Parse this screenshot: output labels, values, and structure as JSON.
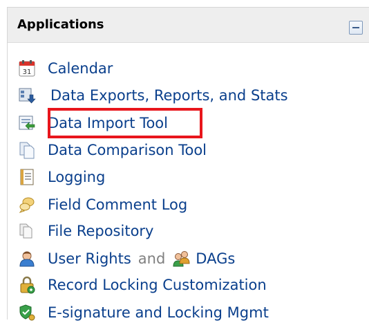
{
  "panel": {
    "title": "Applications"
  },
  "items": [
    {
      "label": "Calendar",
      "icon": "calendar-icon"
    },
    {
      "label": "Data Exports, Reports, and Stats",
      "icon": "data-export-icon"
    },
    {
      "label": "Data Import Tool",
      "icon": "data-import-icon",
      "highlighted": true
    },
    {
      "label": "Data Comparison Tool",
      "icon": "documents-icon"
    },
    {
      "label": "Logging",
      "icon": "log-icon"
    },
    {
      "label": "Field Comment Log",
      "icon": "comment-balloon-icon"
    },
    {
      "label": "File Repository",
      "icon": "file-repository-icon"
    },
    {
      "label": "User Rights",
      "icon": "user-icon",
      "joiner": "and",
      "second_label": "DAGs",
      "second_icon": "group-icon"
    },
    {
      "label": "Record Locking Customization",
      "icon": "lock-icon"
    },
    {
      "label": "E-signature and Locking Mgmt",
      "icon": "shield-check-icon"
    }
  ],
  "colors": {
    "link": "#0a3f8c",
    "highlight_border": "#e8161c",
    "header_bg": "#eeeeee"
  }
}
